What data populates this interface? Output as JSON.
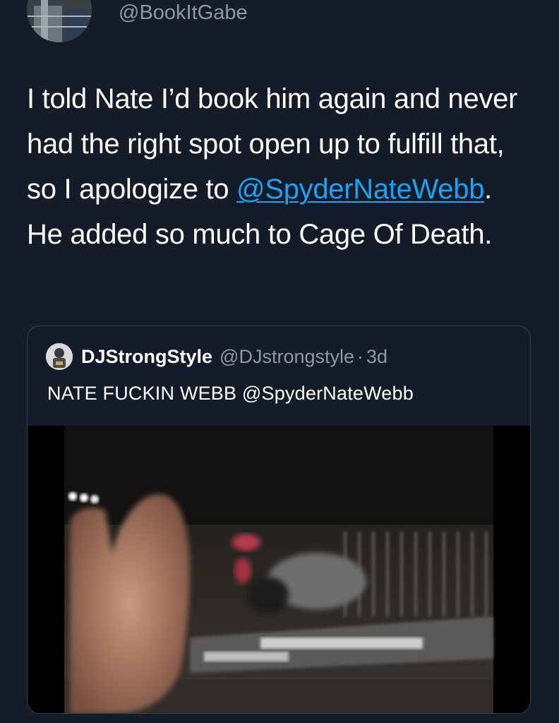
{
  "tweet": {
    "handle": "@BookItGabe",
    "text_part1": "I told Nate I’d book him again and never had the right spot open up to fulfill that, so I apologize to ",
    "mention": "@SpyderNateWebb",
    "text_part2": ". He added so much to Cage Of Death."
  },
  "quoted_tweet": {
    "display_name": "DJStrongStyle",
    "handle": "@DJstrongstyle",
    "separator": "·",
    "time": "3d",
    "text": "NATE FUCKIN WEBB @SpyderNateWebb",
    "media_type": "video"
  },
  "colors": {
    "background": "#151c29",
    "text_primary": "#ffffff",
    "text_secondary": "#8d99a6",
    "link": "#1da1f2",
    "border": "#38444d"
  }
}
